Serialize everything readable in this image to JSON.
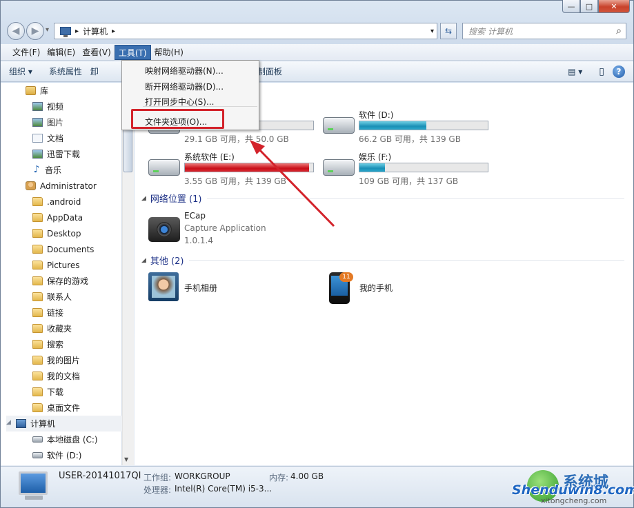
{
  "window": {
    "caption_min": "—",
    "caption_max": "□",
    "caption_close": "✕"
  },
  "nav": {
    "back": "◀",
    "forward": "▶",
    "recent": "▾"
  },
  "address": {
    "separator1": "▸",
    "location": "计算机",
    "separator2": "▸",
    "dropdown": "▾",
    "refresh": "⇆"
  },
  "search": {
    "placeholder": "搜索 计算机",
    "icon": "⌕"
  },
  "menu": {
    "items": [
      "文件(F)",
      "编辑(E)",
      "查看(V)",
      "工具(T)",
      "帮助(H)"
    ],
    "active": "工具(T)"
  },
  "toolbar": {
    "organize": "组织 ▾",
    "system_props": "系统属性",
    "partial": "卸",
    "control_panel": "打开控制面板",
    "view_icon": "▤ ▾",
    "pane_icon": "▯",
    "help_icon": "?"
  },
  "tools_menu": {
    "items": [
      "映射网络驱动器(N)...",
      "断开网络驱动器(D)...",
      "打开同步中心(S)...",
      "文件夹选项(O)..."
    ],
    "highlighted": "文件夹选项(O)..."
  },
  "sidebar": {
    "libraries": "库",
    "videos": "视频",
    "pictures": "图片",
    "documents": "文档",
    "thunder": "迅雷下载",
    "music": "音乐",
    "admin": "Administrator",
    "android": ".android",
    "appdata": "AppData",
    "desktop": "Desktop",
    "documents_en": "Documents",
    "pictures_en": "Pictures",
    "saved_games": "保存的游戏",
    "contacts": "联系人",
    "links": "链接",
    "favorites": "收藏夹",
    "searches": "搜索",
    "my_pictures": "我的图片",
    "my_docs": "我的文档",
    "downloads": "下载",
    "desktop_files": "桌面文件",
    "computer": "计算机",
    "local_c": "本地磁盘 (C:)",
    "soft_d": "软件 (D:)"
  },
  "drives": [
    {
      "name": "",
      "size": "29.1 GB 可用，共 50.0 GB",
      "used": 0.42,
      "red": false
    },
    {
      "name": "软件 (D:)",
      "size": "66.2 GB 可用，共 139 GB",
      "used": 0.52,
      "red": false
    },
    {
      "name": "系统软件 (E:)",
      "size": "3.55 GB 可用，共 139 GB",
      "used": 0.97,
      "red": true
    },
    {
      "name": "娱乐 (F:)",
      "size": "109 GB 可用，共 137 GB",
      "used": 0.2,
      "red": false
    }
  ],
  "network": {
    "group": "网络位置 (1)",
    "ecap_name": "ECap",
    "ecap_desc": "Capture Application",
    "ecap_ver": "1.0.1.4"
  },
  "other": {
    "group": "其他 (2)",
    "album": "手机相册",
    "phone": "我的手机",
    "badge": "11"
  },
  "status": {
    "pc_name": "USER-20141017QI",
    "wg_label": "工作组:",
    "wg_value": "WORKGROUP",
    "mem_label": "内存:",
    "mem_value": "4.00 GB",
    "cpu_label": "处理器:",
    "cpu_value": "Intel(R) Core(TM) i5-3..."
  },
  "watermark": {
    "brand": "Shenduwin8.com",
    "sub": "xitongcheng.com",
    "cn": "系统城"
  },
  "colors": {
    "menu_active": "#3a6fb0",
    "drive_blue": "#1a8fb5",
    "drive_red": "#c80f19",
    "highlight": "#d3232b",
    "arrow": "#d3232b"
  }
}
